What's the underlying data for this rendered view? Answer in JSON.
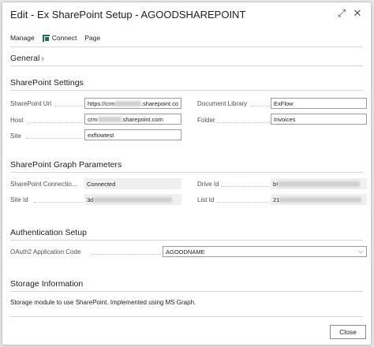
{
  "window": {
    "title": "Edit - Ex SharePoint Setup - AGOODSHAREPOINT",
    "expand_glyph": "⤢",
    "close_glyph": "✕"
  },
  "toolbar": {
    "manage_label": "Manage",
    "connect_label": "Connect",
    "page_label": "Page"
  },
  "general": {
    "title": "General",
    "chevron": "›"
  },
  "sharepoint_settings": {
    "title": "SharePoint Settings",
    "url_label": "SharePoint Url",
    "url_value_prefix": "https://crm",
    "url_value_suffix": ".sharepoint.co",
    "host_label": "Host",
    "host_value_prefix": "crm",
    "host_value_suffix": ".sharepoint.com",
    "site_label": "Site",
    "site_value": "exflowtest",
    "doclib_label": "Document Library",
    "doclib_value": "ExFlow",
    "folder_label": "Folder",
    "folder_value": "Invoices"
  },
  "graph_parameters": {
    "title": "SharePoint Graph Parameters",
    "connection_label": "SharePoint Connectio...",
    "connection_value": "Connected",
    "siteid_label": "Site Id",
    "siteid_value_prefix": "3d",
    "driveid_label": "Drive Id",
    "driveid_value_prefix": "b!",
    "listid_label": "List Id",
    "listid_value_prefix": "21"
  },
  "authentication": {
    "title": "Authentication Setup",
    "oauth_label": "OAuth2 Application Code",
    "oauth_value": "AGOODNAME",
    "select_chevron": "⌵"
  },
  "storage": {
    "title": "Storage Information",
    "description": "Storage module to use SharePoint. Implemented using MS Graph."
  },
  "footer": {
    "close_label": "Close"
  }
}
